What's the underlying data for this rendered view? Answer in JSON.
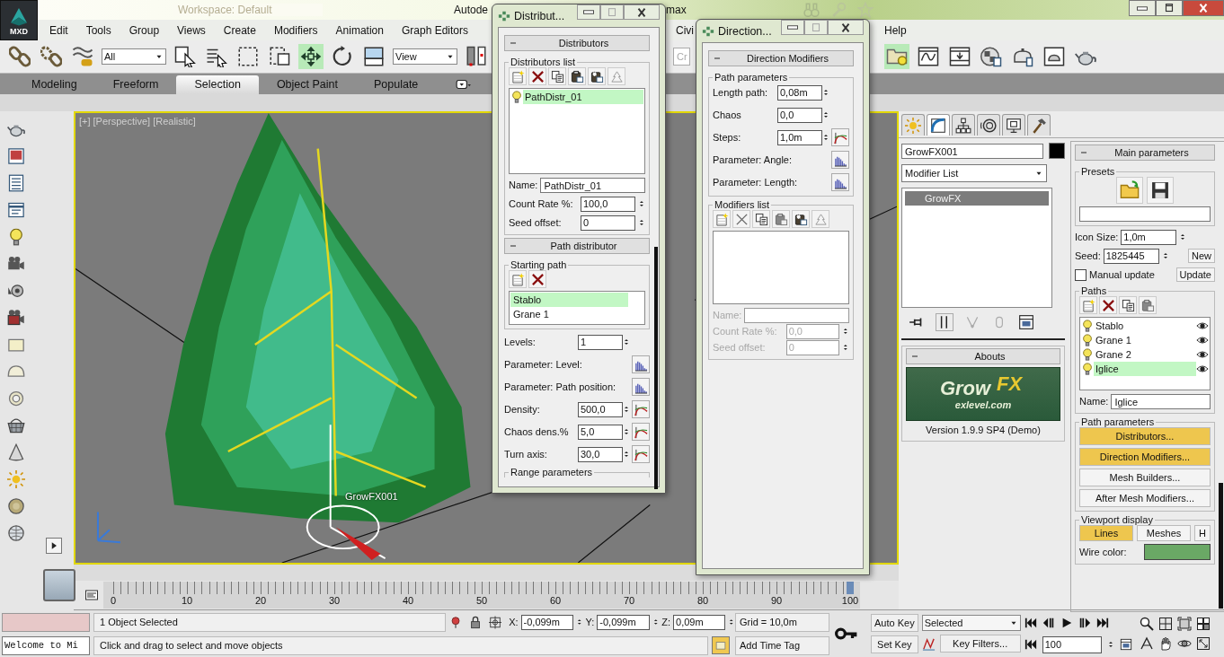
{
  "title_bar": {
    "app_button": "MXD",
    "workspace": "Workspace: Default",
    "title": "Autode",
    "title_end": "max"
  },
  "menu": [
    "Edit",
    "Tools",
    "Group",
    "Views",
    "Create",
    "Modifiers",
    "Animation",
    "Graph Editors",
    "Civi",
    "Help"
  ],
  "toolbar": {
    "selection_filter": "All",
    "reference_coordinate": "View",
    "named_selection": "Cr"
  },
  "ribbon_tabs": [
    {
      "label": "Modeling",
      "selected": false
    },
    {
      "label": "Freeform",
      "selected": false
    },
    {
      "label": "Selection",
      "selected": true
    },
    {
      "label": "Object Paint",
      "selected": false
    },
    {
      "label": "Populate",
      "selected": false
    }
  ],
  "viewport": {
    "labels": [
      "[+]",
      "[Perspective]",
      "[Realistic]"
    ],
    "object_label": "GrowFX001"
  },
  "timeline": {
    "ticks": [
      "0",
      "10",
      "20",
      "30",
      "40",
      "50",
      "60",
      "70",
      "80",
      "90",
      "100"
    ],
    "level": 1
  },
  "command_panel": {
    "tabs": [
      {
        "selected": false
      },
      {
        "selected": true
      },
      {
        "selected": false
      },
      {
        "selected": false
      },
      {
        "selected": false
      },
      {
        "selected": false
      }
    ],
    "object_name": "GrowFX001",
    "modifier_list": "Modifier List",
    "stack": [
      {
        "label": "GrowFX",
        "selected": true
      }
    ],
    "abouts": {
      "title": "Abouts",
      "logo_grow": "Grow",
      "logo_fx": "FX",
      "logo_site": "exlevel.com",
      "version": "Version 1.9.9 SP4 (Demo)"
    },
    "main": {
      "title": "Main parameters",
      "presets": "Presets",
      "icon_size_label": "Icon Size:",
      "icon_size": "1,0m",
      "seed_label": "Seed:",
      "seed": "1825445",
      "new_button": "New",
      "manual_update": {
        "label": "Manual update",
        "checked": false
      },
      "update_button": "Update",
      "paths_group": "Paths",
      "paths": [
        {
          "name": "Stablo",
          "selected": false,
          "visible": true
        },
        {
          "name": "Grane 1",
          "selected": false,
          "visible": true
        },
        {
          "name": "Grane 2",
          "selected": false,
          "visible": true
        },
        {
          "name": "Iglice",
          "selected": true,
          "visible": true
        }
      ],
      "name_label": "Name:",
      "name": "Iglice",
      "path_params_group": "Path parameters",
      "path_buttons": [
        {
          "label": "Distributors...",
          "active": true
        },
        {
          "label": "Direction Modifiers...",
          "active": true
        },
        {
          "label": "Mesh Builders...",
          "active": false
        },
        {
          "label": "After Mesh Modifiers...",
          "active": false
        }
      ],
      "display_group": "Viewport display",
      "display_buttons": [
        {
          "label": "Lines",
          "selected": true
        },
        {
          "label": "Meshes",
          "selected": false
        },
        {
          "label": "H",
          "selected": false
        }
      ],
      "wire_label": "Wire color:"
    }
  },
  "status_bar": {
    "prompt": "1 Object Selected",
    "hint": "Click and drag to select and move objects",
    "listener": "Welcome to Mi",
    "coords": [
      {
        "axis": "X:",
        "value": "-0,099m"
      },
      {
        "axis": "Y:",
        "value": "-0,099m"
      },
      {
        "axis": "Z:",
        "value": "0,09m"
      }
    ],
    "grid": "Grid = 10,0m",
    "time_tag": "Add Time Tag",
    "auto_key": "Auto Key",
    "set_key": "Set Key",
    "key_mode": "Selected",
    "key_filters": "Key Filters...",
    "frame": "100"
  },
  "distributors_dialog": {
    "title": "Distribut...",
    "rollout": "Distributors",
    "list_group": "Distributors list",
    "items": [
      {
        "name": "PathDistr_01",
        "selected": true
      }
    ],
    "name_label": "Name:",
    "name": "PathDistr_01",
    "count_label": "Count Rate %:",
    "count": "100,0",
    "seed_label": "Seed offset:",
    "seed": "0",
    "path_rollout": "Path distributor",
    "start_group": "Starting path",
    "paths": [
      {
        "name": "Stablo",
        "selected": true
      },
      {
        "name": "Grane 1",
        "selected": false
      }
    ],
    "params": [
      {
        "kind": "spinner",
        "label": "Levels:",
        "value": "1"
      },
      {
        "kind": "histogram",
        "label": "Parameter: Level:"
      },
      {
        "kind": "histogram",
        "label": "Parameter: Path position:"
      },
      {
        "kind": "curve",
        "label": "Density:",
        "value": "500,0"
      },
      {
        "kind": "curve",
        "label": "Chaos dens.%",
        "value": "5,0"
      },
      {
        "kind": "curve",
        "label": "Turn axis:",
        "value": "30,0"
      }
    ],
    "range_group": "Range parameters"
  },
  "direction_dialog": {
    "title": "Direction...",
    "rollout": "Direction Modifiers",
    "path_group": "Path parameters",
    "params": [
      {
        "kind": "spinner",
        "label": "Length path:",
        "value": "0,08m"
      },
      {
        "kind": "spinner",
        "label": "Chaos",
        "value": "0,0"
      },
      {
        "kind": "curve",
        "label": "Steps:",
        "value": "1,0m"
      },
      {
        "kind": "histogram",
        "label": "Parameter: Angle:"
      },
      {
        "kind": "histogram",
        "label": "Parameter: Length:"
      }
    ],
    "mod_group": "Modifiers list",
    "disabled": true,
    "name_label": "Name:",
    "count_label": "Count Rate %:",
    "count": "0,0",
    "seed_label": "Seed offset:",
    "seed": "0"
  }
}
